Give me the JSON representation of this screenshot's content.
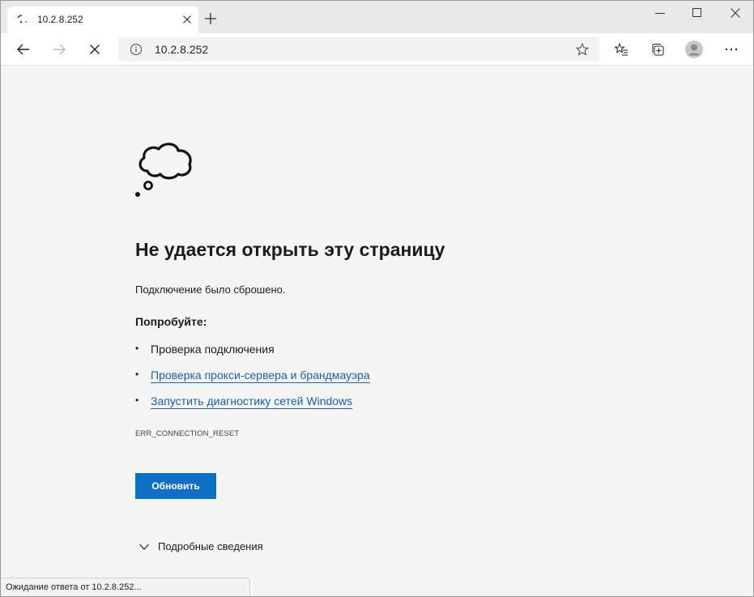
{
  "tab": {
    "title": "10.2.8.252"
  },
  "address": {
    "url": "10.2.8.252"
  },
  "error": {
    "title": "Не удается открыть эту страницу",
    "description": "Подключение было сброшено.",
    "try_label": "Попробуйте:",
    "suggestions": [
      {
        "bullet": "•",
        "text": "Проверка подключения"
      },
      {
        "bullet": "•",
        "text": "Проверка прокси-сервера и брандмауэра"
      },
      {
        "bullet": "•",
        "text": "Запустить диагностику сетей Windows"
      }
    ],
    "code": "ERR_CONNECTION_RESET",
    "reload_label": "Обновить",
    "details_label": "Подробные сведения"
  },
  "status": {
    "text": "Ожидание ответа от 10.2.8.252..."
  },
  "colors": {
    "link": "#1a5fa8",
    "button": "#0e6fc4",
    "page_bg": "#f5f5f5"
  },
  "icons": [
    "loading-icon",
    "close-icon",
    "plus-icon",
    "minimize-icon",
    "maximize-icon",
    "window-close-icon",
    "back-arrow-icon",
    "forward-arrow-icon",
    "stop-icon",
    "info-icon",
    "star-icon",
    "favorites-icon",
    "collections-icon",
    "profile-icon",
    "more-icon",
    "thought-cloud-icon",
    "chevron-down-icon"
  ]
}
